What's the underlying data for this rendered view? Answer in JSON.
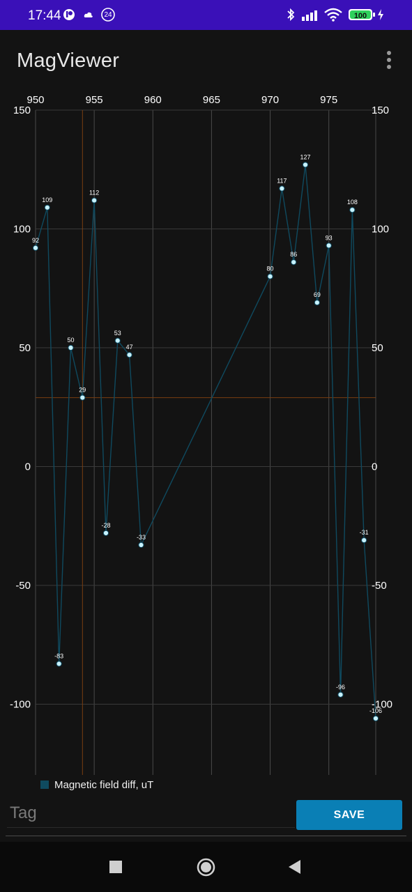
{
  "status_bar": {
    "time": "17:44",
    "notification_badge": "24",
    "battery": "100",
    "icons": [
      "app-notification-icon",
      "cloud-icon",
      "badge-icon",
      "bluetooth-icon",
      "signal-icon",
      "wifi-icon",
      "battery-icon",
      "charging-icon"
    ]
  },
  "app_bar": {
    "title": "MagViewer",
    "menu_icon": "more-vert-icon"
  },
  "chart_data": {
    "type": "line",
    "title": "",
    "xlabel": "",
    "ylabel": "",
    "xlim": [
      950,
      979
    ],
    "ylim": [
      -125,
      150
    ],
    "x_ticks": [
      950,
      955,
      960,
      965,
      970,
      975
    ],
    "y_ticks": [
      150,
      100,
      50,
      0,
      -50,
      -100
    ],
    "x_tick_position": "top",
    "y_tick_position": "left-and-right",
    "grid": true,
    "legend": "bottom-left",
    "crosshair": {
      "x": 954,
      "y": 29,
      "color": "#7a3e10"
    },
    "series": [
      {
        "name": "Magnetic field diff, uT",
        "color": "#0f4a5f",
        "point_color": "#c8f2ff",
        "x": [
          950,
          951,
          952,
          953,
          954,
          955,
          956,
          957,
          958,
          959,
          970,
          971,
          972,
          973,
          974,
          975,
          976,
          977,
          978,
          979
        ],
        "values": [
          92,
          109,
          -83,
          50,
          29,
          112,
          -28,
          53,
          47,
          -33,
          80,
          117,
          86,
          127,
          69,
          93,
          -96,
          108,
          -31,
          -106
        ],
        "labels": [
          "92",
          "109",
          "-83",
          "50",
          "29",
          "112",
          "-28",
          "53",
          "47",
          "-33",
          "80",
          "117",
          "86",
          "127",
          "69",
          "93",
          "-96",
          "108",
          "-31",
          "-106"
        ]
      }
    ]
  },
  "tag": {
    "placeholder": "Tag",
    "value": ""
  },
  "save_label": "SAVE",
  "nav": {
    "recents_icon": "recents-square-icon",
    "home_icon": "home-circle-icon",
    "back_icon": "back-triangle-icon"
  }
}
